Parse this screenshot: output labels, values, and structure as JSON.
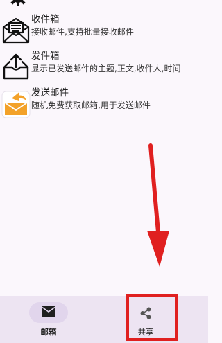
{
  "menu": [
    {
      "title": "收件箱",
      "desc": "接收邮件,支持批量接收邮件",
      "icon": "inbox-envelope-icon"
    },
    {
      "title": "发件箱",
      "desc": "显示已发送邮件的主题,正文,收件人,时间",
      "icon": "outbox-upload-icon"
    },
    {
      "title": "发送邮件",
      "desc": "随机免费获取邮箱,用于发送邮件",
      "icon": "send-mail-icon"
    }
  ],
  "bottom_nav": {
    "tabs": [
      {
        "label": "邮箱",
        "icon": "mail-icon",
        "selected": true
      },
      {
        "label": "共享",
        "icon": "share-icon",
        "selected": false
      }
    ]
  },
  "colors": {
    "background": "#fbf7fc",
    "nav_background": "#ede4f2",
    "selected_pill": "#e1d5ec",
    "annotation_red": "#e02020",
    "send_icon_orange": "#f3a229"
  },
  "annotations": {
    "arrow_icon": "red-arrow-icon",
    "highlight": "red-highlight-box"
  }
}
